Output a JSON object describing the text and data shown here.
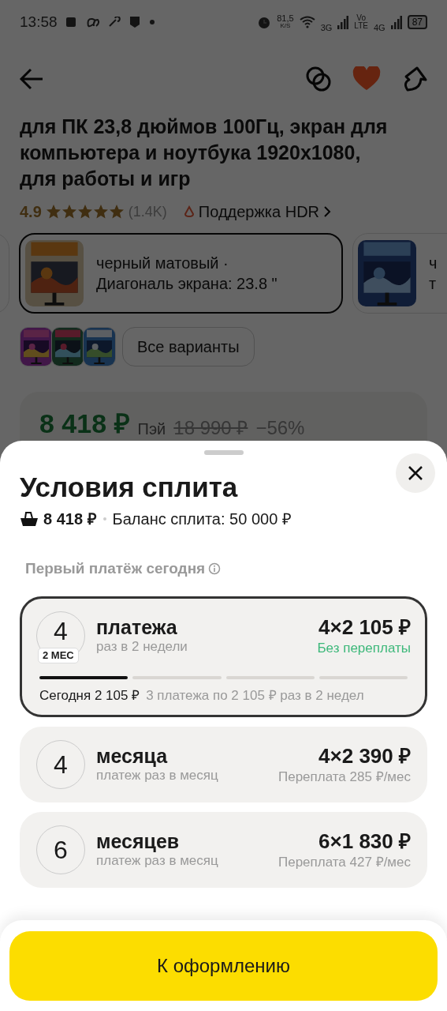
{
  "status_bar": {
    "time": "13:58",
    "speed": "81,5",
    "speed_unit": "K/S",
    "network_1": "3G",
    "volte_top": "Vo",
    "volte_bottom": "LTE",
    "network_2": "4G",
    "battery": "87"
  },
  "header": {
    "favorite": true
  },
  "product": {
    "title_lines": [
      "для ПК 23,8 дюймов 100Гц, экран для",
      "компьютера и ноутбука 1920x1080,",
      "для работы и игр"
    ],
    "rating": "4.9",
    "stars": 5,
    "reviews": "(1.4K)",
    "feature": "Поддержка HDR"
  },
  "variants": [
    {
      "selected": false
    },
    {
      "lines": [
        "черный матовый ·",
        "Диагональ экрана: 23.8 \""
      ],
      "selected": true
    },
    {
      "lines": [
        "ч",
        "т"
      ],
      "selected": false
    }
  ],
  "all_variants": "Все варианты",
  "price": {
    "current": "8 418 ₽",
    "pay": "Пэй",
    "old": "18 990 ₽",
    "discount": "−56%"
  },
  "sheet": {
    "title": "Условия сплита",
    "total": "8 418 ₽",
    "balance": "Баланс сплита: 50 000 ₽",
    "first_payment": "Первый платёж сегодня",
    "plans": [
      {
        "count": "4",
        "badge": "2 МЕС",
        "title": "платежа",
        "subtitle": "раз в 2 недели",
        "amount": "4×2 105 ₽",
        "note": "Без переплаты",
        "overpay": false,
        "selected": true,
        "segments": [
          {
            "done": true
          },
          {
            "done": false
          },
          {
            "done": false
          },
          {
            "done": false
          }
        ],
        "today": "Сегодня 2 105 ₽",
        "rest": "3 платежа по 2 105 ₽ раз в 2 недел"
      },
      {
        "count": "4",
        "title": "месяца",
        "subtitle": "платеж раз в месяц",
        "amount": "4×2 390 ₽",
        "note": "Переплата 285 ₽/мес",
        "overpay": true,
        "selected": false
      },
      {
        "count": "6",
        "title": "месяцев",
        "subtitle": "платеж раз в месяц",
        "amount": "6×1 830 ₽",
        "note": "Переплата 427 ₽/мес",
        "overpay": true,
        "selected": false
      }
    ],
    "button": "К оформлению"
  }
}
